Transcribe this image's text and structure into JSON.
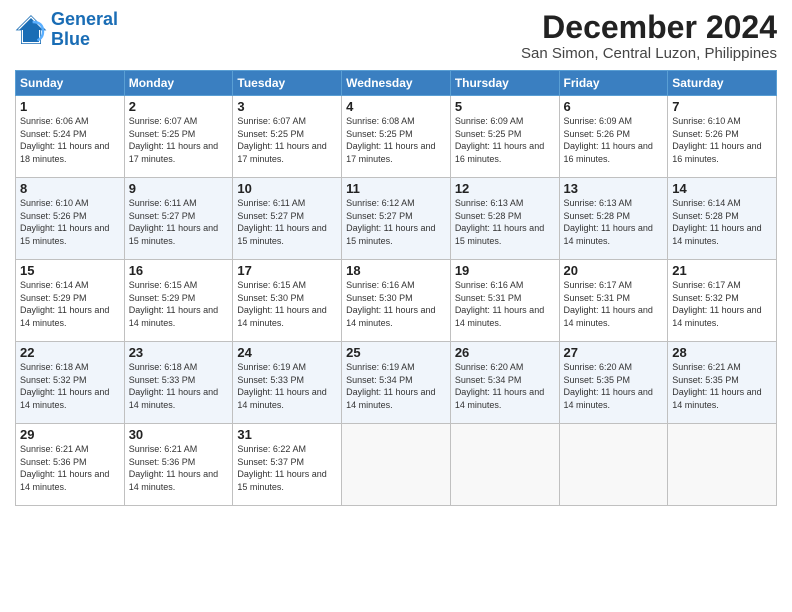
{
  "logo": {
    "line1": "General",
    "line2": "Blue"
  },
  "title": "December 2024",
  "location": "San Simon, Central Luzon, Philippines",
  "days_header": [
    "Sunday",
    "Monday",
    "Tuesday",
    "Wednesday",
    "Thursday",
    "Friday",
    "Saturday"
  ],
  "weeks": [
    [
      {
        "day": "1",
        "sunrise": "6:06 AM",
        "sunset": "5:24 PM",
        "daylight": "11 hours and 18 minutes."
      },
      {
        "day": "2",
        "sunrise": "6:07 AM",
        "sunset": "5:25 PM",
        "daylight": "11 hours and 17 minutes."
      },
      {
        "day": "3",
        "sunrise": "6:07 AM",
        "sunset": "5:25 PM",
        "daylight": "11 hours and 17 minutes."
      },
      {
        "day": "4",
        "sunrise": "6:08 AM",
        "sunset": "5:25 PM",
        "daylight": "11 hours and 17 minutes."
      },
      {
        "day": "5",
        "sunrise": "6:09 AM",
        "sunset": "5:25 PM",
        "daylight": "11 hours and 16 minutes."
      },
      {
        "day": "6",
        "sunrise": "6:09 AM",
        "sunset": "5:26 PM",
        "daylight": "11 hours and 16 minutes."
      },
      {
        "day": "7",
        "sunrise": "6:10 AM",
        "sunset": "5:26 PM",
        "daylight": "11 hours and 16 minutes."
      }
    ],
    [
      {
        "day": "8",
        "sunrise": "6:10 AM",
        "sunset": "5:26 PM",
        "daylight": "11 hours and 15 minutes."
      },
      {
        "day": "9",
        "sunrise": "6:11 AM",
        "sunset": "5:27 PM",
        "daylight": "11 hours and 15 minutes."
      },
      {
        "day": "10",
        "sunrise": "6:11 AM",
        "sunset": "5:27 PM",
        "daylight": "11 hours and 15 minutes."
      },
      {
        "day": "11",
        "sunrise": "6:12 AM",
        "sunset": "5:27 PM",
        "daylight": "11 hours and 15 minutes."
      },
      {
        "day": "12",
        "sunrise": "6:13 AM",
        "sunset": "5:28 PM",
        "daylight": "11 hours and 15 minutes."
      },
      {
        "day": "13",
        "sunrise": "6:13 AM",
        "sunset": "5:28 PM",
        "daylight": "11 hours and 14 minutes."
      },
      {
        "day": "14",
        "sunrise": "6:14 AM",
        "sunset": "5:28 PM",
        "daylight": "11 hours and 14 minutes."
      }
    ],
    [
      {
        "day": "15",
        "sunrise": "6:14 AM",
        "sunset": "5:29 PM",
        "daylight": "11 hours and 14 minutes."
      },
      {
        "day": "16",
        "sunrise": "6:15 AM",
        "sunset": "5:29 PM",
        "daylight": "11 hours and 14 minutes."
      },
      {
        "day": "17",
        "sunrise": "6:15 AM",
        "sunset": "5:30 PM",
        "daylight": "11 hours and 14 minutes."
      },
      {
        "day": "18",
        "sunrise": "6:16 AM",
        "sunset": "5:30 PM",
        "daylight": "11 hours and 14 minutes."
      },
      {
        "day": "19",
        "sunrise": "6:16 AM",
        "sunset": "5:31 PM",
        "daylight": "11 hours and 14 minutes."
      },
      {
        "day": "20",
        "sunrise": "6:17 AM",
        "sunset": "5:31 PM",
        "daylight": "11 hours and 14 minutes."
      },
      {
        "day": "21",
        "sunrise": "6:17 AM",
        "sunset": "5:32 PM",
        "daylight": "11 hours and 14 minutes."
      }
    ],
    [
      {
        "day": "22",
        "sunrise": "6:18 AM",
        "sunset": "5:32 PM",
        "daylight": "11 hours and 14 minutes."
      },
      {
        "day": "23",
        "sunrise": "6:18 AM",
        "sunset": "5:33 PM",
        "daylight": "11 hours and 14 minutes."
      },
      {
        "day": "24",
        "sunrise": "6:19 AM",
        "sunset": "5:33 PM",
        "daylight": "11 hours and 14 minutes."
      },
      {
        "day": "25",
        "sunrise": "6:19 AM",
        "sunset": "5:34 PM",
        "daylight": "11 hours and 14 minutes."
      },
      {
        "day": "26",
        "sunrise": "6:20 AM",
        "sunset": "5:34 PM",
        "daylight": "11 hours and 14 minutes."
      },
      {
        "day": "27",
        "sunrise": "6:20 AM",
        "sunset": "5:35 PM",
        "daylight": "11 hours and 14 minutes."
      },
      {
        "day": "28",
        "sunrise": "6:21 AM",
        "sunset": "5:35 PM",
        "daylight": "11 hours and 14 minutes."
      }
    ],
    [
      {
        "day": "29",
        "sunrise": "6:21 AM",
        "sunset": "5:36 PM",
        "daylight": "11 hours and 14 minutes."
      },
      {
        "day": "30",
        "sunrise": "6:21 AM",
        "sunset": "5:36 PM",
        "daylight": "11 hours and 14 minutes."
      },
      {
        "day": "31",
        "sunrise": "6:22 AM",
        "sunset": "5:37 PM",
        "daylight": "11 hours and 15 minutes."
      },
      null,
      null,
      null,
      null
    ]
  ]
}
